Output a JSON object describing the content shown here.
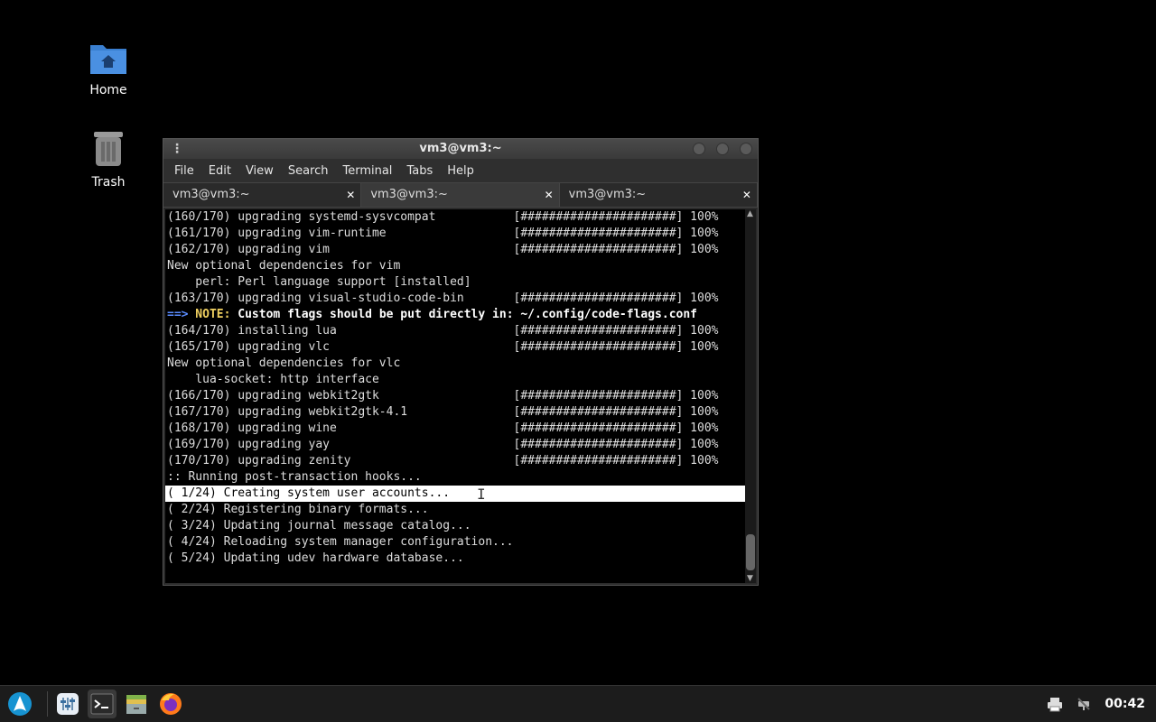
{
  "desktop": {
    "home_label": "Home",
    "trash_label": "Trash"
  },
  "window": {
    "title": "vm3@vm3:~",
    "menu": [
      "File",
      "Edit",
      "View",
      "Search",
      "Terminal",
      "Tabs",
      "Help"
    ],
    "tabs": [
      {
        "label": "vm3@vm3:~",
        "active": false
      },
      {
        "label": "vm3@vm3:~",
        "active": true
      },
      {
        "label": "vm3@vm3:~",
        "active": false
      }
    ]
  },
  "terminal": {
    "lines": [
      "(160/170) upgrading systemd-sysvcompat           [######################] 100%",
      "(161/170) upgrading vim-runtime                  [######################] 100%",
      "(162/170) upgrading vim                          [######################] 100%",
      "New optional dependencies for vim",
      "    perl: Perl language support [installed]",
      "(163/170) upgrading visual-studio-code-bin       [######################] 100%",
      "__NOTE__",
      "(164/170) installing lua                         [######################] 100%",
      "(165/170) upgrading vlc                          [######################] 100%",
      "New optional dependencies for vlc",
      "    lua-socket: http interface",
      "(166/170) upgrading webkit2gtk                   [######################] 100%",
      "(167/170) upgrading webkit2gtk-4.1               [######################] 100%",
      "(168/170) upgrading wine                         [######################] 100%",
      "(169/170) upgrading yay                          [######################] 100%",
      "(170/170) upgrading zenity                       [######################] 100%",
      ":: Running post-transaction hooks...",
      "( 1/24) Creating system user accounts...",
      "( 2/24) Registering binary formats...",
      "( 3/24) Updating journal message catalog...",
      "( 4/24) Reloading system manager configuration...",
      "( 5/24) Updating udev hardware database..."
    ],
    "note": {
      "arrow": "==>",
      "label": "NOTE:",
      "text": "Custom flags should be put directly in: ~/.config/code-flags.conf"
    },
    "highlighted_line": 17
  },
  "taskbar": {
    "clock": "00:42"
  }
}
